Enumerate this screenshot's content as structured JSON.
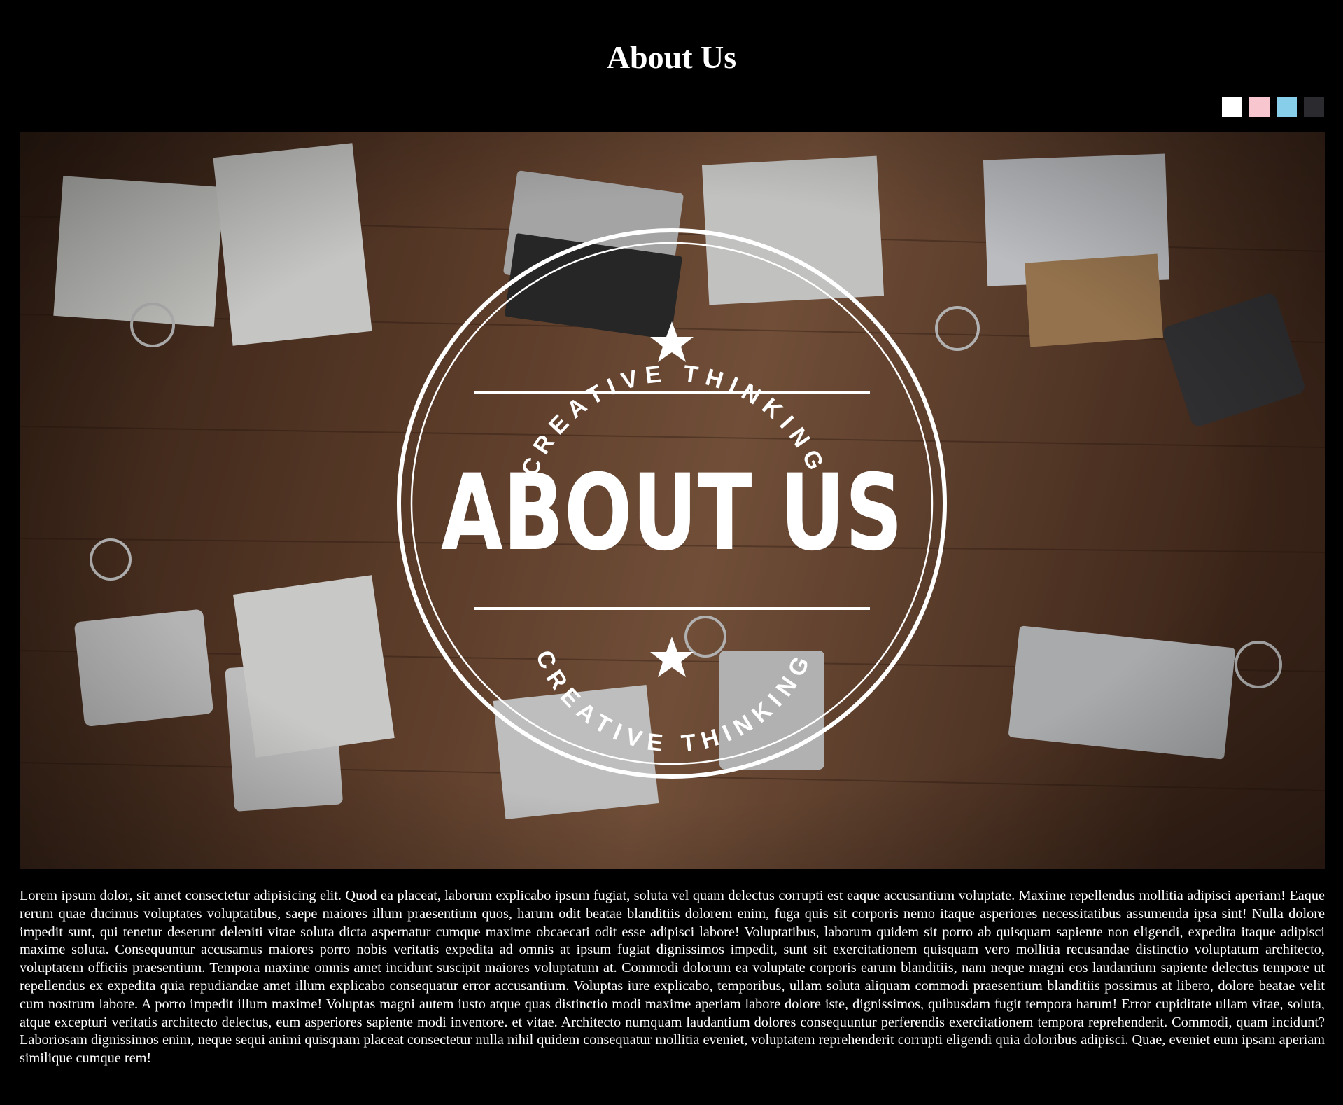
{
  "page": {
    "title": "About Us"
  },
  "theme_switcher": {
    "swatches": [
      {
        "name": "white",
        "color": "#ffffff"
      },
      {
        "name": "pink",
        "color": "#f7c6cf"
      },
      {
        "name": "light-blue",
        "color": "#87ceeb"
      },
      {
        "name": "dark",
        "color": "#2b2b2f"
      }
    ]
  },
  "hero_image": {
    "badge_title": "ABOUT US",
    "badge_top_text": "CREATIVE THINKING",
    "badge_bottom_text": "CREATIVE THINKING",
    "colors": {
      "wood_dark": "#3a2418",
      "wood_mid": "#6b4630",
      "wood_light": "#8a6045",
      "badge": "#ffffff"
    }
  },
  "content": {
    "paragraph": "Lorem ipsum dolor, sit amet consectetur adipisicing elit. Quod ea placeat, laborum explicabo ipsum fugiat, soluta vel quam delectus corrupti est eaque accusantium voluptate. Maxime repellendus mollitia adipisci aperiam! Eaque rerum quae ducimus voluptates voluptatibus, saepe maiores illum praesentium quos, harum odit beatae blanditiis dolorem enim, fuga quis sit corporis nemo itaque asperiores necessitatibus assumenda ipsa sint! Nulla dolore impedit sunt, qui tenetur deserunt deleniti vitae soluta dicta aspernatur cumque maxime obcaecati odit esse adipisci labore! Voluptatibus, laborum quidem sit porro ab quisquam sapiente non eligendi, expedita itaque adipisci maxime soluta. Consequuntur accusamus maiores porro nobis veritatis expedita ad omnis at ipsum fugiat dignissimos impedit, sunt sit exercitationem quisquam vero mollitia recusandae distinctio voluptatum architecto, voluptatem officiis praesentium. Tempora maxime omnis amet incidunt suscipit maiores voluptatum at. Commodi dolorum ea voluptate corporis earum blanditiis, nam neque magni eos laudantium sapiente delectus tempore ut repellendus ex expedita quia repudiandae amet illum explicabo consequatur error accusantium. Voluptas iure explicabo, temporibus, ullam soluta aliquam commodi praesentium blanditiis possimus at libero, dolore beatae velit cum nostrum labore. A porro impedit illum maxime! Voluptas magni autem iusto atque quas distinctio modi maxime aperiam labore dolore iste, dignissimos, quibusdam fugit tempora harum! Error cupiditate ullam vitae, soluta, atque excepturi veritatis architecto delectus, eum asperiores sapiente modi inventore. et vitae. Architecto numquam laudantium dolores consequuntur perferendis exercitationem tempora reprehenderit. Commodi, quam incidunt? Laboriosam dignissimos enim, neque sequi animi quisquam placeat consectetur nulla nihil quidem consequatur mollitia eveniet, voluptatem reprehenderit corrupti eligendi quia doloribus adipisci. Quae, eveniet eum ipsam aperiam similique cumque rem!"
  }
}
